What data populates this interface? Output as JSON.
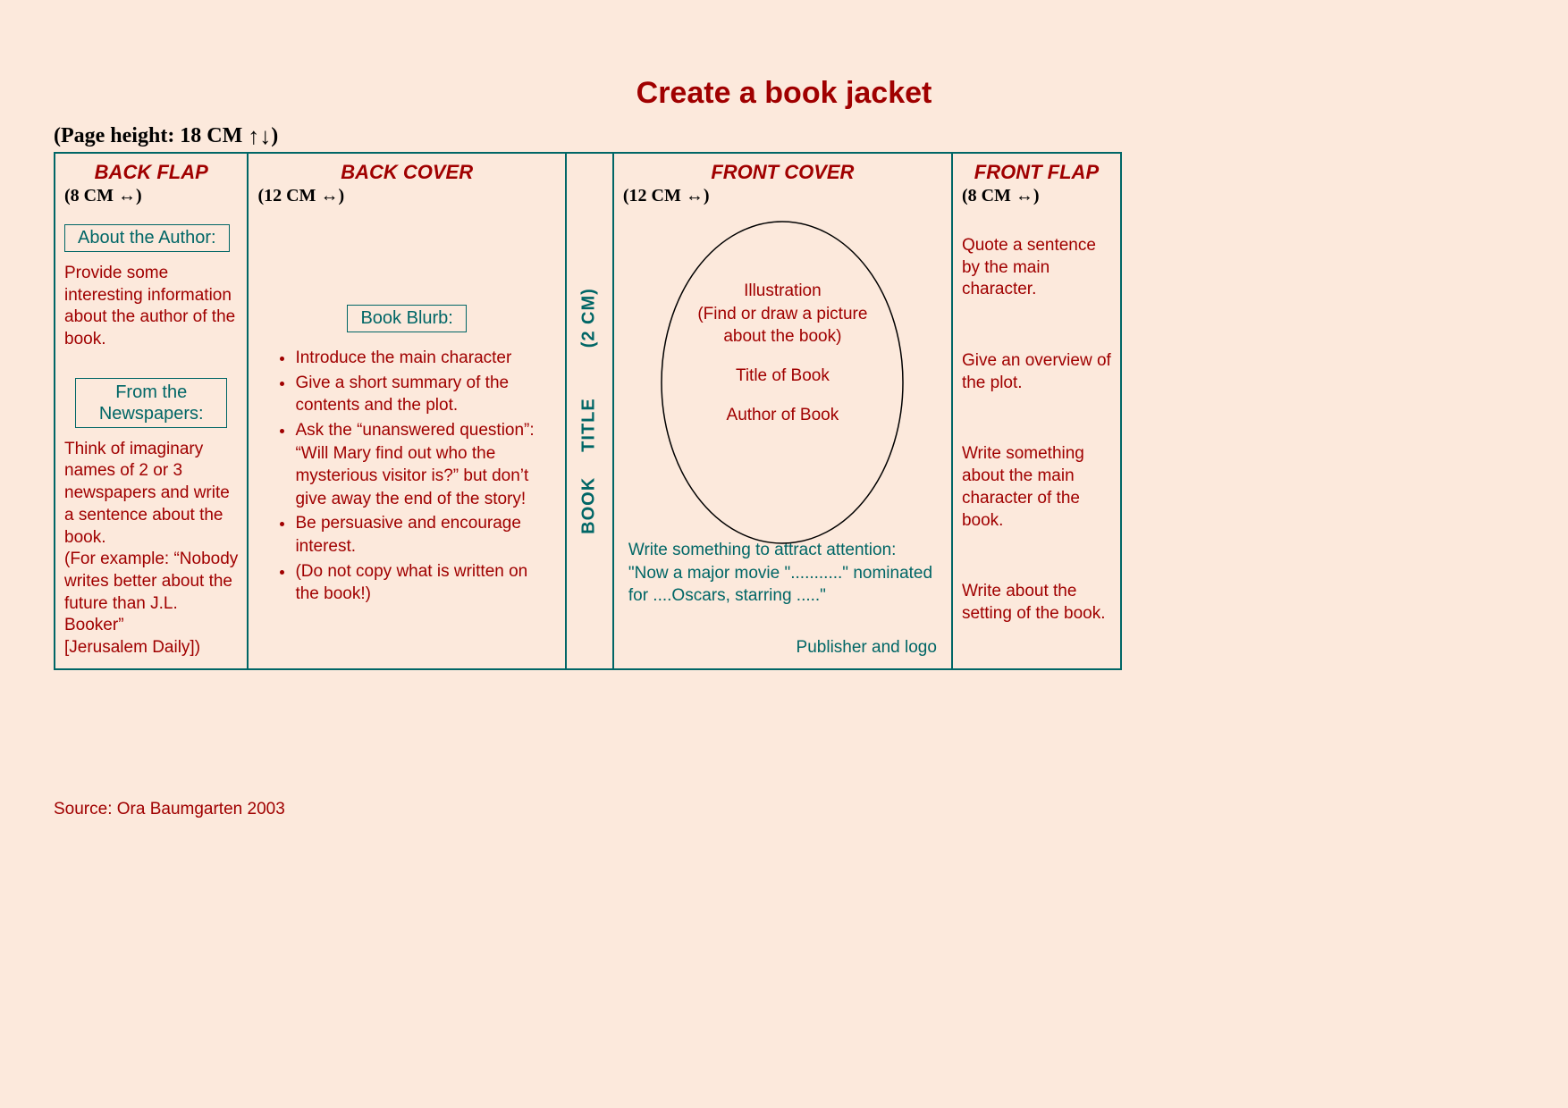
{
  "title": "Create a book jacket",
  "page_height_label": "(Page height: 18 CM ",
  "page_height_arrows": "↑↓",
  "page_height_close": ")",
  "lr": "↔",
  "back_flap": {
    "title": "BACK FLAP",
    "dim": "(8 CM ",
    "dim_close": ")",
    "about_label": "About the Author:",
    "about_text": "Provide some interesting information about the author of the book.",
    "news_label": "From the Newspapers:",
    "news_text": "Think of imaginary names of 2 or 3 newspapers and write a sentence about the book.\n(For example: “Nobody writes better about the future than J.L. Booker”\n[Jerusalem Daily])"
  },
  "back_cover": {
    "title": "BACK COVER",
    "dim": "(12 CM ",
    "dim_close": ")",
    "blurb_label": "Book Blurb:",
    "bullets": [
      "Introduce the main character",
      "Give a short summary of the contents and the plot.",
      "Ask the “unanswered question”: “Will Mary find out who the mysterious visitor is?” but don’t give away the end of the story!",
      "Be persuasive and encourage interest.",
      "(Do not copy what is written on the book!)"
    ]
  },
  "spine": {
    "book": "BOOK",
    "title": "TITLE",
    "dim": "(2  CM)"
  },
  "front_cover": {
    "title": "FRONT COVER",
    "dim": "(12 CM ",
    "dim_close": ")",
    "illustration": "Illustration\n(Find or draw a picture about the book)",
    "title_of_book": "Title of Book",
    "author_of_book": "Author of Book",
    "attract": "Write something to attract attention:\n\"Now a major movie \"...........\" nominated for ....Oscars, starring .....\"",
    "publisher": "Publisher and logo"
  },
  "front_flap": {
    "title": "FRONT FLAP",
    "dim": "(8 CM ",
    "dim_close": ")",
    "p1": "Quote a sentence by the main character.",
    "p2": "Give an overview of the plot.",
    "p3": "Write something about the main character of the book.",
    "p4": "Write about the setting of the book."
  },
  "source": "Source:  Ora Baumgarten 2003"
}
